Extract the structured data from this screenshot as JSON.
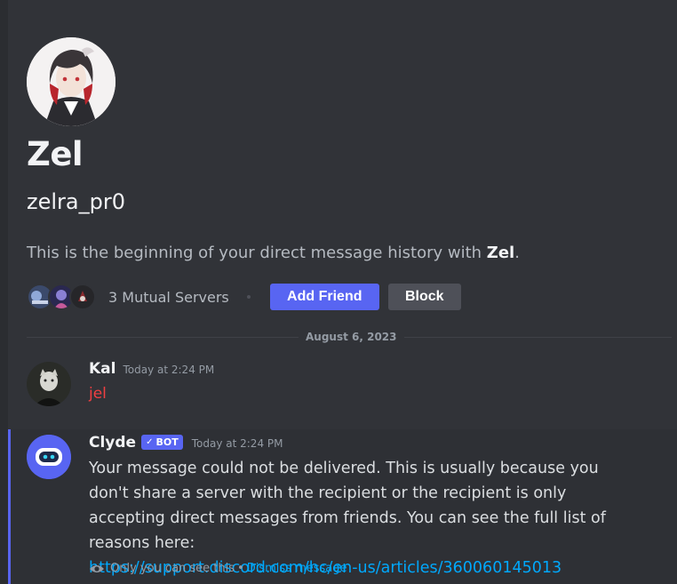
{
  "profile": {
    "display_name": "Zel",
    "username": "zelra_pr0",
    "intro_prefix": "This is the beginning of your direct message history with ",
    "intro_name": "Zel",
    "intro_suffix": ".",
    "mutual_servers": "3 Mutual Servers",
    "add_friend_label": "Add Friend",
    "block_label": "Block"
  },
  "date_divider": "August 6, 2023",
  "messages": [
    {
      "author": "Kal",
      "timestamp": "Today at 2:24 PM",
      "content": "jel",
      "content_color": "#f23f42"
    },
    {
      "author": "Clyde",
      "badge": "BOT",
      "timestamp": "Today at 2:24 PM",
      "content": "Your message could not be delivered. This is usually because you don't share a server with the recipient or the recipient is only accepting direct messages from friends. You can see the full list of reasons here:",
      "link": "https://support.discord.com/hc/en-us/articles/360060145013",
      "ephemeral_note": "Only you can see this",
      "ephemeral_separator": "•",
      "dismiss_label": "Dismiss message"
    }
  ],
  "colors": {
    "background": "#313338",
    "blurple": "#5865f2",
    "link": "#00a8fc"
  },
  "icons": {
    "verified": "checkmark-icon",
    "ephemeral": "eye-icon"
  }
}
